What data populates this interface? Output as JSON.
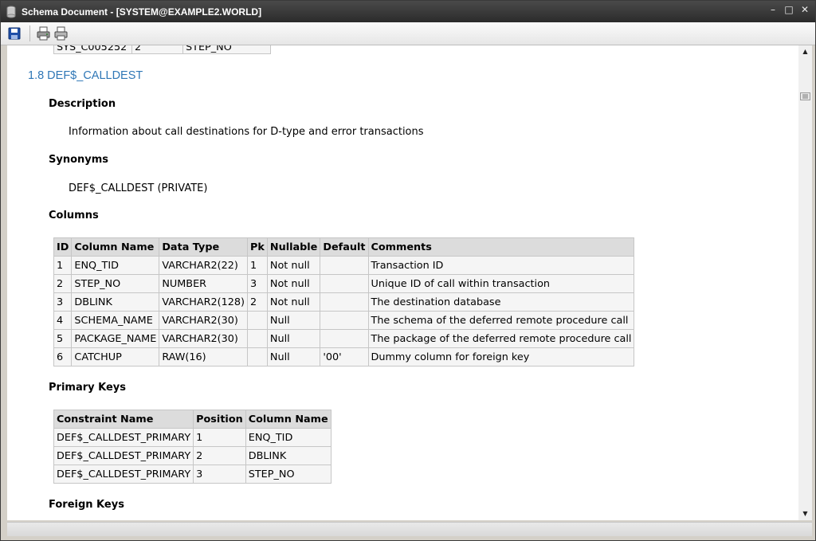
{
  "window": {
    "title": "Schema Document - [SYSTEM@EXAMPLE2.WORLD]"
  },
  "toolbar": {
    "save": "save-icon",
    "print_preview": "print-preview-icon",
    "print": "print-icon"
  },
  "prev_table_row": [
    "SYS_C005252",
    "2",
    "STEP_NO"
  ],
  "section": {
    "title": "1.8 DEF$_CALLDEST",
    "description_heading": "Description",
    "description": "Information about call destinations for D-type and error transactions",
    "synonyms_heading": "Synonyms",
    "synonyms": "DEF$_CALLDEST (PRIVATE)",
    "columns_heading": "Columns",
    "primary_keys_heading": "Primary Keys",
    "foreign_keys_heading": "Foreign Keys"
  },
  "columns_table": {
    "headers": [
      "ID",
      "Column Name",
      "Data Type",
      "Pk",
      "Nullable",
      "Default",
      "Comments"
    ],
    "rows": [
      [
        "1",
        "ENQ_TID",
        "VARCHAR2(22)",
        "1",
        "Not null",
        "",
        "Transaction ID"
      ],
      [
        "2",
        "STEP_NO",
        "NUMBER",
        "3",
        "Not null",
        "",
        "Unique ID of call within transaction"
      ],
      [
        "3",
        "DBLINK",
        "VARCHAR2(128)",
        "2",
        "Not null",
        "",
        "The destination database"
      ],
      [
        "4",
        "SCHEMA_NAME",
        "VARCHAR2(30)",
        "",
        "Null",
        "",
        "The schema of the deferred remote procedure call"
      ],
      [
        "5",
        "PACKAGE_NAME",
        "VARCHAR2(30)",
        "",
        "Null",
        "",
        "The package of the deferred remote procedure call"
      ],
      [
        "6",
        "CATCHUP",
        "RAW(16)",
        "",
        "Null",
        "'00'",
        "Dummy column for foreign key"
      ]
    ]
  },
  "pk_table": {
    "headers": [
      "Constraint Name",
      "Position",
      "Column Name"
    ],
    "rows": [
      [
        "DEF$_CALLDEST_PRIMARY",
        "1",
        "ENQ_TID"
      ],
      [
        "DEF$_CALLDEST_PRIMARY",
        "2",
        "DBLINK"
      ],
      [
        "DEF$_CALLDEST_PRIMARY",
        "3",
        "STEP_NO"
      ]
    ]
  }
}
